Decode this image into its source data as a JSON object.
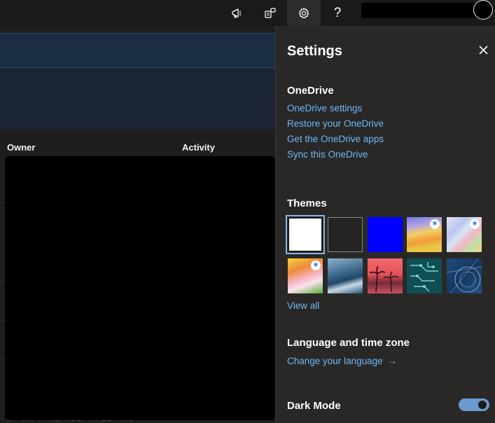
{
  "topbar": {
    "icons": [
      "megaphone-icon",
      "feedback-icon",
      "gear-icon",
      "help-icon"
    ],
    "help_glyph": "?"
  },
  "main": {
    "columns": {
      "owner": "Owner",
      "activity": "Activity"
    },
    "footer_partial": "OF ON TYNE HOSPITALS NHS"
  },
  "settings": {
    "title": "Settings",
    "onedrive": {
      "heading": "OneDrive",
      "links": [
        "OneDrive settings",
        "Restore your OneDrive",
        "Get the OneDrive apps",
        "Sync this OneDrive"
      ]
    },
    "themes": {
      "heading": "Themes",
      "view_all": "View all",
      "selected_index": 0,
      "items": [
        {
          "name": "theme-white",
          "starred": false
        },
        {
          "name": "theme-dark-gray",
          "starred": false
        },
        {
          "name": "theme-blue",
          "starred": false
        },
        {
          "name": "theme-rainbow-waves",
          "starred": true
        },
        {
          "name": "theme-pastel-lines",
          "starred": true
        },
        {
          "name": "theme-anime-art",
          "starred": true
        },
        {
          "name": "theme-ocean-wave",
          "starred": false
        },
        {
          "name": "theme-palm-sunset",
          "starred": false
        },
        {
          "name": "theme-circuit",
          "starred": false
        },
        {
          "name": "theme-blueprint",
          "starred": false
        }
      ]
    },
    "language": {
      "heading": "Language and time zone",
      "link": "Change your language",
      "arrow": "→"
    },
    "dark_mode": {
      "label": "Dark Mode",
      "enabled": true
    },
    "colors": {
      "accent_link": "#6cb8f6",
      "toggle_on": "#6a9bd0"
    }
  }
}
